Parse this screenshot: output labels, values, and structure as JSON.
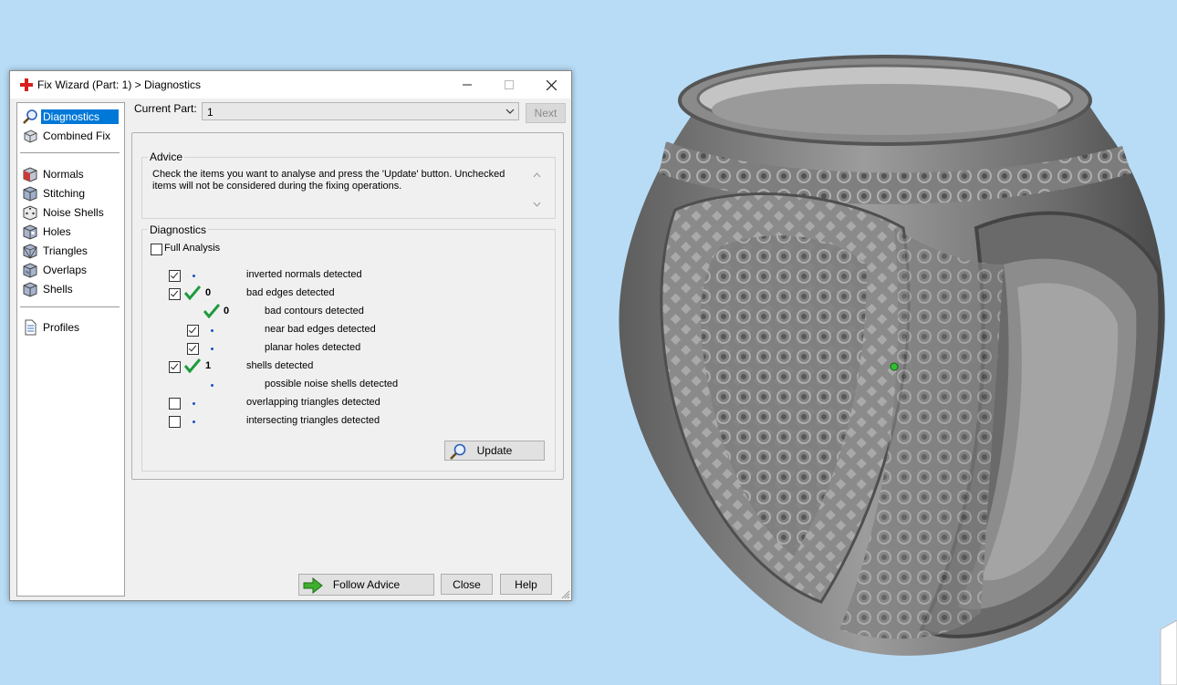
{
  "window": {
    "title": "Fix Wizard (Part: 1) > Diagnostics",
    "title_icon": "red-cross-icon",
    "controls": [
      "minimize",
      "maximize",
      "close"
    ]
  },
  "sidebar": {
    "groups": [
      [
        {
          "label": "Diagnostics",
          "icon": "magnifier-icon",
          "selected": true
        },
        {
          "label": "Combined Fix",
          "icon": "cubes-icon",
          "selected": false
        }
      ],
      [
        {
          "label": "Normals",
          "icon": "cube-red-face-icon",
          "selected": false
        },
        {
          "label": "Stitching",
          "icon": "cube-stitching-icon",
          "selected": false
        },
        {
          "label": "Noise Shells",
          "icon": "dice-icon",
          "selected": false
        },
        {
          "label": "Holes",
          "icon": "cube-holes-icon",
          "selected": false
        },
        {
          "label": "Triangles",
          "icon": "cube-triangles-icon",
          "selected": false
        },
        {
          "label": "Overlaps",
          "icon": "cube-overlaps-icon",
          "selected": false
        },
        {
          "label": "Shells",
          "icon": "cube-shells-icon",
          "selected": false
        }
      ],
      [
        {
          "label": "Profiles",
          "icon": "document-icon",
          "selected": false
        }
      ]
    ]
  },
  "current_part": {
    "label": "Current Part:",
    "value": "1",
    "next_label": "Next"
  },
  "advice": {
    "title": "Advice",
    "line1": "Check the items you want to analyse and press the 'Update' button. Unchecked",
    "line2": "items will not be considered during the fixing operations."
  },
  "diagnostics": {
    "title": "Diagnostics",
    "full_analysis_label": "Full Analysis",
    "full_analysis_checked": false,
    "rows": [
      {
        "checkbox": true,
        "checked": true,
        "status": "dot",
        "count": "",
        "text": "inverted normals detected",
        "indent": 0
      },
      {
        "checkbox": true,
        "checked": true,
        "status": "ok",
        "count": "0",
        "text": "bad edges detected",
        "indent": 0
      },
      {
        "checkbox": false,
        "checked": false,
        "status": "ok",
        "count": "0",
        "text": "bad contours detected",
        "indent": 1
      },
      {
        "checkbox": true,
        "checked": true,
        "status": "dot",
        "count": "",
        "text": "near bad edges detected",
        "indent": 1
      },
      {
        "checkbox": true,
        "checked": true,
        "status": "dot",
        "count": "",
        "text": "planar holes detected",
        "indent": 1
      },
      {
        "checkbox": true,
        "checked": true,
        "status": "ok",
        "count": "1",
        "text": "shells detected",
        "indent": 0
      },
      {
        "checkbox": false,
        "checked": false,
        "status": "dot",
        "count": "",
        "text": "possible noise shells detected",
        "indent": 1
      },
      {
        "checkbox": true,
        "checked": false,
        "status": "dot",
        "count": "",
        "text": "overlapping triangles detected",
        "indent": 0
      },
      {
        "checkbox": true,
        "checked": false,
        "status": "dot",
        "count": "",
        "text": "intersecting triangles detected",
        "indent": 0
      }
    ],
    "update_label": "Update"
  },
  "footer": {
    "follow_advice_label": "Follow Advice",
    "close_label": "Close",
    "help_label": "Help"
  },
  "viewport": {
    "background": "#b8dcf6",
    "model": "ornate-signet-ring-icon"
  },
  "colors": {
    "selection": "#0078d7",
    "check_green": "#1e9b3c",
    "dot_blue": "#1f4fc7"
  }
}
